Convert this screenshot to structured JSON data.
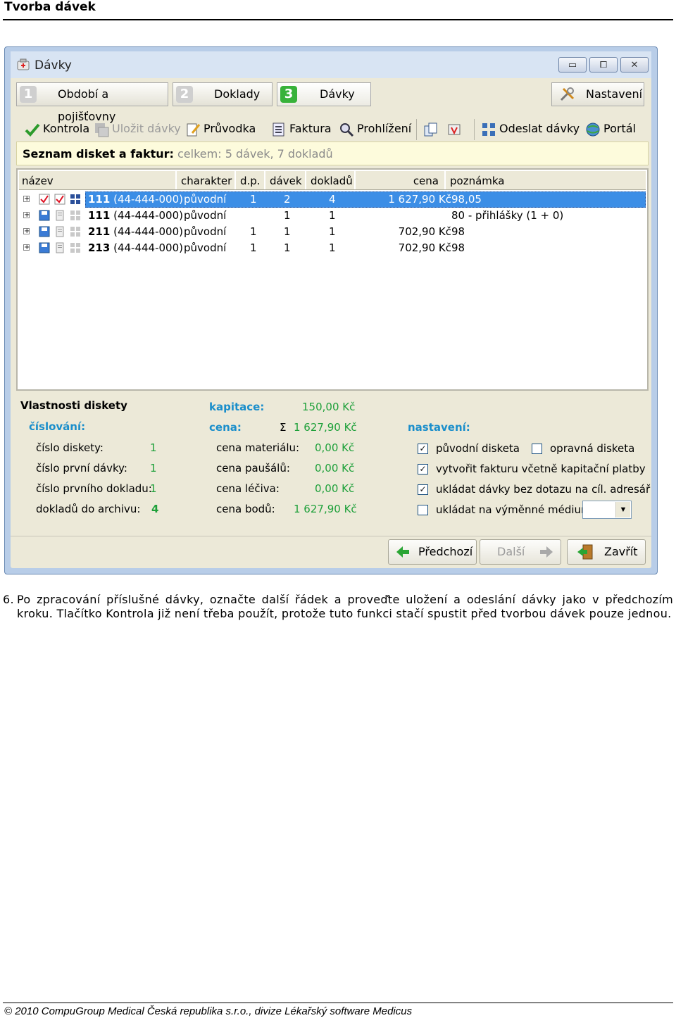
{
  "header": {
    "title": "Tvorba dávek"
  },
  "window": {
    "title": "Dávky",
    "controls": {
      "minimize": "▭",
      "maximize": "⧠",
      "close": "✕"
    },
    "tabs": [
      {
        "number": "1",
        "label": "Období a pojišťovny"
      },
      {
        "number": "2",
        "label": "Doklady"
      },
      {
        "number": "3",
        "label": "Dávky"
      }
    ],
    "settings_label": "Nastavení",
    "toolbar": {
      "kontrola": "Kontrola",
      "ulozit": "Uložit dávky",
      "pruvodka": "Průvodka",
      "faktura": "Faktura",
      "prohlizeni": "Prohlížení",
      "odeslat": "Odeslat dávky",
      "portal": "Portál"
    },
    "infobar": {
      "title": "Seznam disket a faktur:",
      "summary": "celkem: 5 dávek, 7 dokladů"
    },
    "grid": {
      "columns": [
        "název",
        "charakter",
        "d.p.",
        "dávek",
        "dokladů",
        "cena",
        "poznámka"
      ],
      "rows": [
        {
          "num": "111",
          "code": "(44-444-000)",
          "charakter": "původní",
          "dp": "1",
          "davek": "2",
          "dokladu": "4",
          "cena": "1 627,90 Kč",
          "poznamka": "98,05",
          "selected": true
        },
        {
          "num": "111",
          "code": "(44-444-000)",
          "charakter": "původní",
          "dp": "",
          "davek": "1",
          "dokladu": "1",
          "cena": "",
          "poznamka": "80 - přihlášky (1 + 0)",
          "selected": false
        },
        {
          "num": "211",
          "code": "(44-444-000)",
          "charakter": "původní",
          "dp": "1",
          "davek": "1",
          "dokladu": "1",
          "cena": "702,90 Kč",
          "poznamka": "98",
          "selected": false
        },
        {
          "num": "213",
          "code": "(44-444-000)",
          "charakter": "původní",
          "dp": "1",
          "davek": "1",
          "dokladu": "1",
          "cena": "702,90 Kč",
          "poznamka": "98",
          "selected": false
        }
      ]
    },
    "props": {
      "title": "Vlastnosti diskety",
      "cislovani_label": "číslování:",
      "cislo_diskety_label": "číslo diskety:",
      "cislo_diskety": "1",
      "cislo_prvni_davky_label": "číslo první dávky:",
      "cislo_prvni_davky": "1",
      "cislo_prvniho_dokladu_label": "číslo prvního dokladu:",
      "cislo_prvniho_dokladu": "1",
      "doklady_archiv_label": "dokladů do archivu:",
      "doklady_archiv": "4",
      "kapitace_label": "kapitace:",
      "kapitace": "150,00 Kč",
      "cena_label": "cena:",
      "sigma": "Σ",
      "cena": "1 627,90 Kč",
      "cena_materialu_label": "cena materiálu:",
      "cena_materialu": "0,00 Kč",
      "cena_pausalu_label": "cena paušálů:",
      "cena_pausalu": "0,00 Kč",
      "cena_leciva_label": "cena léčiva:",
      "cena_leciva": "0,00 Kč",
      "cena_bodu_label": "cena bodů:",
      "cena_bodu": "1 627,90 Kč",
      "nastaveni_label": "nastavení:",
      "chk_puvodni": "původní disketa",
      "chk_opravna": "opravná disketa",
      "chk_faktura": "vytvořit fakturu včetně kapitační platby",
      "chk_ukladat": "ukládat dávky bez dotazu na cíl. adresář",
      "chk_medium": "ukládat na výměnné médium:",
      "check_mark": "✓"
    },
    "buttons": {
      "predchozi": "Předchozí",
      "dalsi": "Další",
      "zavrit": "Zavřít"
    }
  },
  "paragraph": {
    "number": "6.",
    "text": "Po zpracování příslušné dávky, označte další řádek a proveďte uložení a odeslání dávky jako v předchozím kroku. Tlačítko Kontrola již není třeba použít, protože tuto funkci stačí spustit před tvorbou dávek pouze jednou."
  },
  "footer": {
    "text": "© 2010 CompuGroup Medical Česká republika s.r.o., divize Lékařský software Medicus"
  }
}
